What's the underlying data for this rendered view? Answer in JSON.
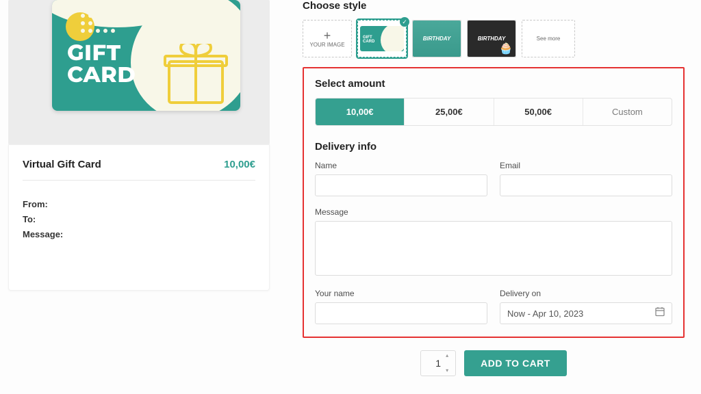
{
  "preview": {
    "card_line1": "GIFT",
    "card_line2": "CARD"
  },
  "summary": {
    "title": "Virtual Gift Card",
    "price": "10,00€",
    "from_label": "From:",
    "to_label": "To:",
    "message_label": "Message:"
  },
  "styles": {
    "heading": "Choose style",
    "your_image": "YOUR IMAGE",
    "mini_line": "GIFT\nCARD",
    "birthday1": "BIRTHDAY",
    "birthday2": "BIRTHDAY",
    "see_more": "See more"
  },
  "amount": {
    "heading": "Select amount",
    "options": [
      "10,00€",
      "25,00€",
      "50,00€",
      "Custom"
    ]
  },
  "delivery": {
    "heading": "Delivery info",
    "name_label": "Name",
    "email_label": "Email",
    "message_label": "Message",
    "your_name_label": "Your name",
    "delivery_on_label": "Delivery on",
    "delivery_value": "Now - Apr 10, 2023"
  },
  "actions": {
    "qty": "1",
    "add_to_cart": "ADD TO CART"
  }
}
